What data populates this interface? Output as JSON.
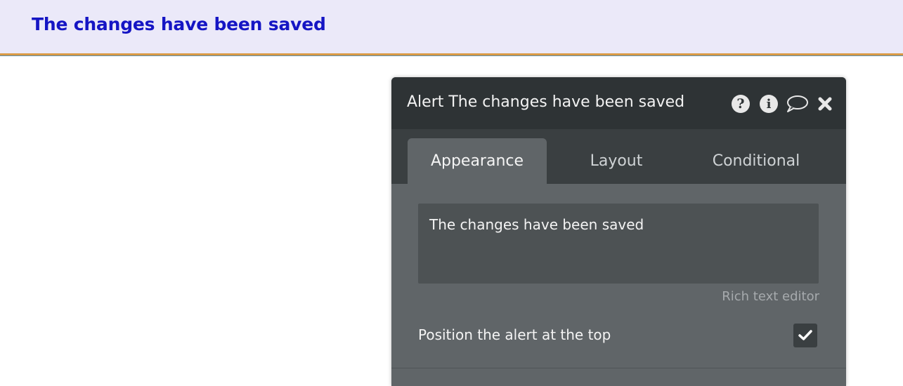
{
  "banner": {
    "text": "The changes have been saved",
    "background": "#ebe9f9",
    "text_color": "#1515c4"
  },
  "panel": {
    "title": "Alert The changes have been saved",
    "header_icons": [
      "question-circle-icon",
      "info-circle-icon",
      "comment-icon",
      "close-icon"
    ],
    "tabs": [
      {
        "label": "Appearance",
        "active": true
      },
      {
        "label": "Layout",
        "active": false
      },
      {
        "label": "Conditional",
        "active": false
      }
    ],
    "content_text": "The changes have been saved",
    "editor_label": "Rich text editor",
    "position_option_label": "Position the alert at the top",
    "position_option_checked": true
  }
}
